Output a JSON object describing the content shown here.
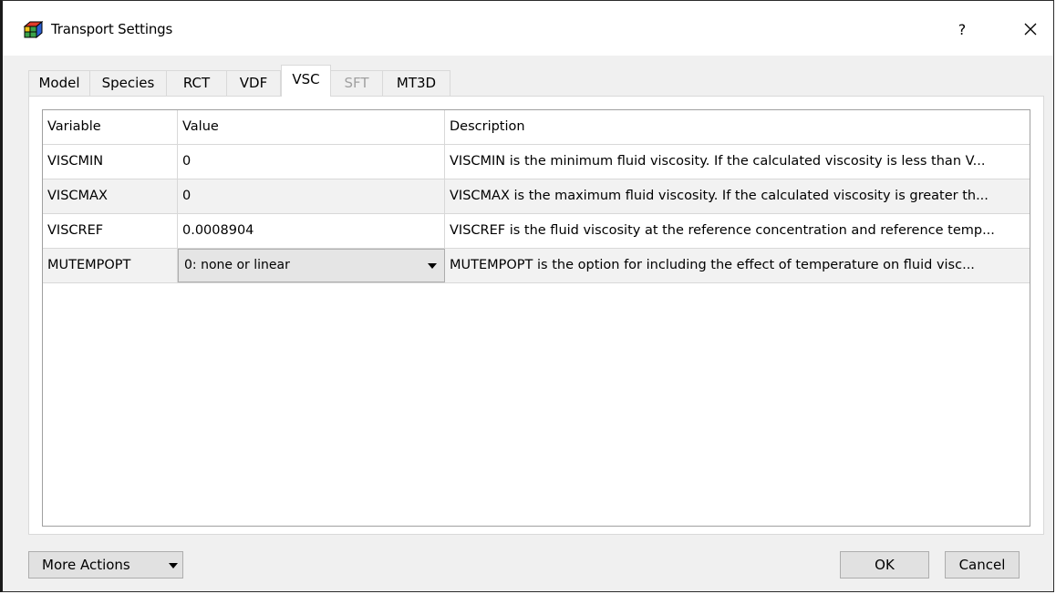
{
  "window": {
    "title": "Transport Settings",
    "help_label": "?",
    "close_label": "✕"
  },
  "tabs": [
    {
      "label": "Model"
    },
    {
      "label": "Species"
    },
    {
      "label": "RCT"
    },
    {
      "label": "VDF"
    },
    {
      "label": "VSC",
      "active": true
    },
    {
      "label": "SFT",
      "disabled": true
    },
    {
      "label": "MT3D"
    }
  ],
  "grid": {
    "columns": [
      "Variable",
      "Value",
      "Description"
    ],
    "rows": [
      {
        "variable": "VISCMIN",
        "value": "0",
        "description": "VISCMIN is the minimum fluid viscosity. If the calculated viscosity is less than V..."
      },
      {
        "variable": "VISCMAX",
        "value": "0",
        "description": "VISCMAX is the maximum fluid viscosity. If the calculated viscosity is greater th..."
      },
      {
        "variable": "VISCREF",
        "value": "0.0008904",
        "description": "VISCREF is the fluid viscosity at the reference concentration and reference temp..."
      },
      {
        "variable": "MUTEMPOPT",
        "value": "0: none or linear",
        "description": "MUTEMPOPT is the option for including the effect of temperature on fluid visc..."
      }
    ]
  },
  "footer": {
    "more_actions": "More Actions",
    "ok": "OK",
    "cancel": "Cancel"
  },
  "icons": {
    "app": "model-grid-icon",
    "dropdown": "chevron-down-icon"
  }
}
